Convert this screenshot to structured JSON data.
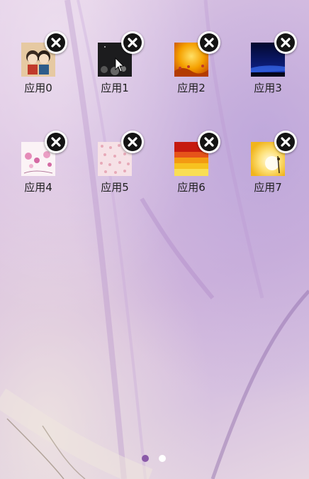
{
  "screen": {
    "background_colors": [
      "#e3cde6",
      "#d4b8dd",
      "#e6d6e2"
    ]
  },
  "apps": [
    {
      "label": "应用0",
      "thumbnail": "children-cartoon-image"
    },
    {
      "label": "应用1",
      "thumbnail": "dark-night-image"
    },
    {
      "label": "应用2",
      "thumbnail": "orange-sunset-image"
    },
    {
      "label": "应用3",
      "thumbnail": "blue-night-image"
    },
    {
      "label": "应用4",
      "thumbnail": "pink-flowers-image"
    },
    {
      "label": "应用5",
      "thumbnail": "pink-pattern-image"
    },
    {
      "label": "应用6",
      "thumbnail": "red-yellow-stripes-image"
    },
    {
      "label": "应用7",
      "thumbnail": "yellow-moon-image"
    }
  ],
  "delete_icon": "close-icon",
  "pager": {
    "page_count": 2,
    "current_page": 0,
    "active_color": "#8a5aa8",
    "inactive_color": "#ffffff"
  }
}
